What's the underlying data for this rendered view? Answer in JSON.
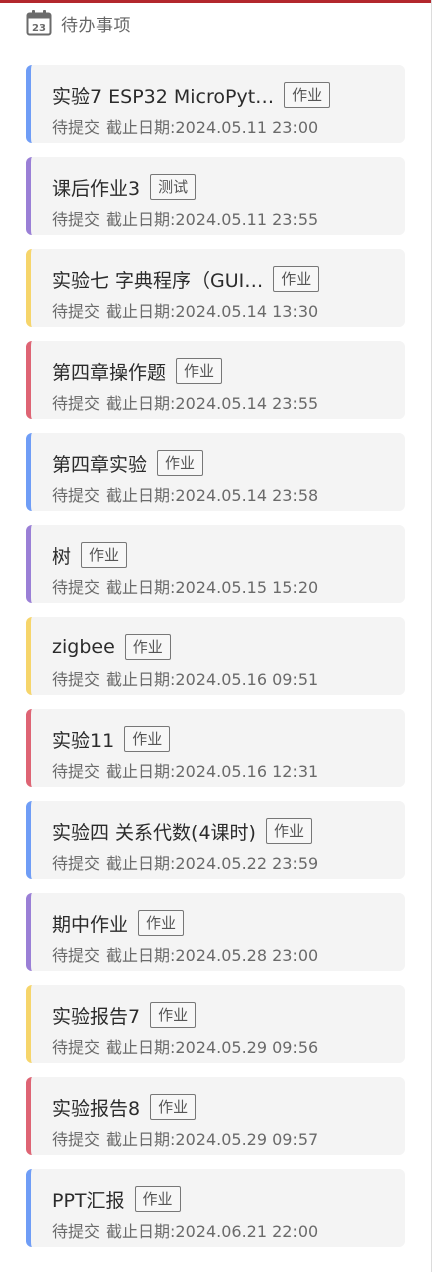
{
  "header": {
    "title": "待办事项",
    "icon": "calendar-icon",
    "icon_day": "23"
  },
  "colors": {
    "top_bar": "#b3272d",
    "blue": "#6f9df6",
    "purple": "#9a7fd6",
    "yellow": "#f6d56b",
    "red": "#de6474"
  },
  "tasks": [
    {
      "title": "实验7 ESP32 MicroPyt…",
      "tag": "作业",
      "status": "待提交",
      "deadline": "截止日期:2024.05.11 23:00",
      "color": "blue"
    },
    {
      "title": "课后作业3",
      "tag": "测试",
      "status": "待提交",
      "deadline": "截止日期:2024.05.11 23:55",
      "color": "purple"
    },
    {
      "title": "实验七 字典程序（GUI…",
      "tag": "作业",
      "status": "待提交",
      "deadline": "截止日期:2024.05.14 13:30",
      "color": "yellow"
    },
    {
      "title": "第四章操作题",
      "tag": "作业",
      "status": "待提交",
      "deadline": "截止日期:2024.05.14 23:55",
      "color": "red"
    },
    {
      "title": "第四章实验",
      "tag": "作业",
      "status": "待提交",
      "deadline": "截止日期:2024.05.14 23:58",
      "color": "blue"
    },
    {
      "title": "树",
      "tag": "作业",
      "status": "待提交",
      "deadline": "截止日期:2024.05.15 15:20",
      "color": "purple"
    },
    {
      "title": "zigbee",
      "tag": "作业",
      "status": "待提交",
      "deadline": "截止日期:2024.05.16 09:51",
      "color": "yellow"
    },
    {
      "title": "实验11",
      "tag": "作业",
      "status": "待提交",
      "deadline": "截止日期:2024.05.16 12:31",
      "color": "red"
    },
    {
      "title": "实验四 关系代数(4课时)",
      "tag": "作业",
      "status": "待提交",
      "deadline": "截止日期:2024.05.22 23:59",
      "color": "blue"
    },
    {
      "title": "期中作业",
      "tag": "作业",
      "status": "待提交",
      "deadline": "截止日期:2024.05.28 23:00",
      "color": "purple"
    },
    {
      "title": "实验报告7",
      "tag": "作业",
      "status": "待提交",
      "deadline": "截止日期:2024.05.29 09:56",
      "color": "yellow"
    },
    {
      "title": "实验报告8",
      "tag": "作业",
      "status": "待提交",
      "deadline": "截止日期:2024.05.29 09:57",
      "color": "red"
    },
    {
      "title": "PPT汇报",
      "tag": "作业",
      "status": "待提交",
      "deadline": "截止日期:2024.06.21 22:00",
      "color": "blue"
    }
  ]
}
